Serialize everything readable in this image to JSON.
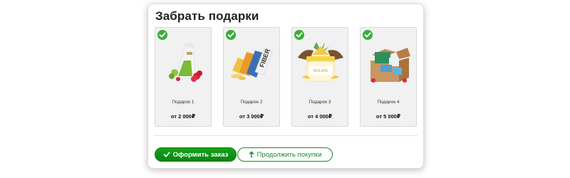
{
  "modal": {
    "title": "Забрать подарки"
  },
  "gifts": [
    {
      "name": "Подарок 1",
      "price": "от 2 000₽",
      "image": "drink-box-with-raspberries",
      "selected": true
    },
    {
      "name": "Подарок 2",
      "price": "от 3 000₽",
      "image": "fiber-bars",
      "selected": true
    },
    {
      "name": "Подарок 3",
      "price": "от 4 000₽",
      "image": "jar-with-pineapple",
      "selected": true
    },
    {
      "name": "Подарок 4",
      "price": "от 5 000₽",
      "image": "gift-box-with-products",
      "selected": true
    }
  ],
  "actions": {
    "order_label": "Оформить заказ",
    "order_icon": "check-icon",
    "continue_label": "Продолжить покупки",
    "continue_icon": "arrow-up-icon"
  },
  "colors": {
    "accent": "#0a8f10",
    "check": "#3aae3a",
    "card_bg": "#f1f1f1"
  }
}
